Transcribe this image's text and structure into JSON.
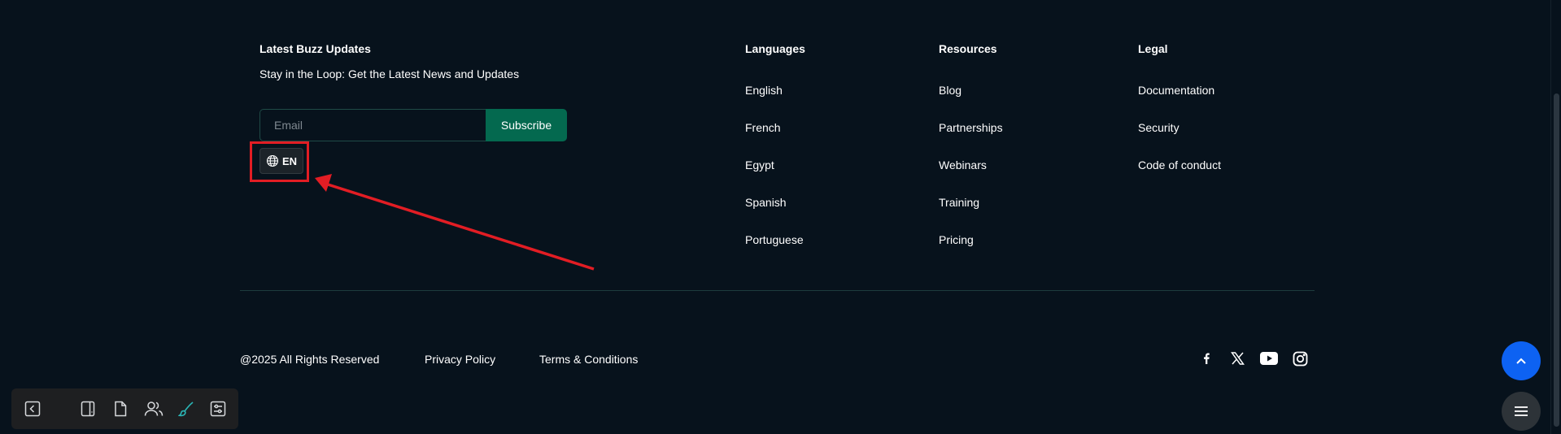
{
  "newsletter": {
    "title": "Latest Buzz Updates",
    "subtitle": "Stay in the Loop: Get the Latest News and Updates",
    "email_placeholder": "Email",
    "email_value": "",
    "subscribe_label": "Subscribe"
  },
  "language_selector": {
    "label": "EN",
    "icon": "globe-icon"
  },
  "columns": {
    "languages": {
      "title": "Languages",
      "items": [
        "English",
        "French",
        "Egypt",
        "Spanish",
        "Portuguese"
      ]
    },
    "resources": {
      "title": "Resources",
      "items": [
        "Blog",
        "Partnerships",
        "Webinars",
        "Training",
        "Pricing"
      ]
    },
    "legal": {
      "title": "Legal",
      "items": [
        "Documentation",
        "Security",
        "Code of conduct"
      ]
    }
  },
  "bottom": {
    "copyright": "@2025 All Rights Reserved",
    "privacy": "Privacy Policy",
    "terms": "Terms & Conditions"
  },
  "social_icons": [
    "facebook-icon",
    "x-icon",
    "youtube-icon",
    "instagram-icon"
  ],
  "floating_buttons": {
    "scroll_top_icon": "chevron-up-icon",
    "menu_icon": "menu-icon"
  },
  "toolbar_icons": [
    "collapse-left-icon",
    "tablet-icon",
    "page-icon",
    "users-icon",
    "brush-icon",
    "settings-sliders-icon"
  ],
  "colors": {
    "background": "#07121c",
    "subscribe_button": "#04694f",
    "annotation": "#e21d24",
    "scroll_top_button": "#0d62f2",
    "active_tool": "#2bb5b5"
  }
}
